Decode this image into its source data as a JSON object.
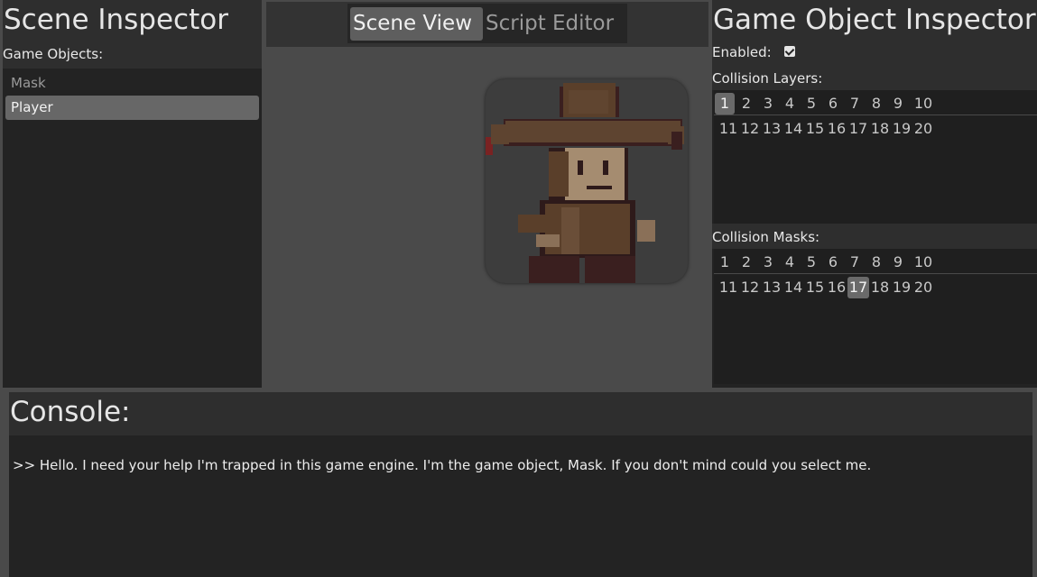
{
  "scene_inspector": {
    "title": "Scene Inspector",
    "objects_label": "Game Objects:",
    "objects": [
      {
        "name": "Mask",
        "selected": false
      },
      {
        "name": "Player",
        "selected": true
      }
    ]
  },
  "center": {
    "tabs": [
      {
        "label": "Scene View",
        "active": true
      },
      {
        "label": "Script Editor",
        "active": false
      }
    ],
    "sprite_icon": "cowboy-character-sprite"
  },
  "inspector": {
    "title": "Game Object Inspector",
    "enabled_label": "Enabled:",
    "enabled_checked": true,
    "layers_label": "Collision Layers:",
    "layers_row1": [
      "1",
      "2",
      "3",
      "4",
      "5",
      "6",
      "7",
      "8",
      "9",
      "10"
    ],
    "layers_row2": [
      "11",
      "12",
      "13",
      "14",
      "15",
      "16",
      "17",
      "18",
      "19",
      "20"
    ],
    "layers_active": [
      "1"
    ],
    "masks_label": "Collision Masks:",
    "masks_row1": [
      "1",
      "2",
      "3",
      "4",
      "5",
      "6",
      "7",
      "8",
      "9",
      "10"
    ],
    "masks_row2": [
      "11",
      "12",
      "13",
      "14",
      "15",
      "16",
      "17",
      "18",
      "19",
      "20"
    ],
    "masks_active": [
      "17"
    ]
  },
  "console": {
    "title": "Console:",
    "text": ">> Hello. I need your help I'm trapped in this game engine. I'm the game object, Mask. If you don't mind could you select me."
  },
  "colors": {
    "background": "#4a4a4a",
    "panel": "#232323",
    "header": "#2e2e2e",
    "selected": "#676767",
    "hat": "#5a3f2a",
    "hat_outline": "#3a1f1f",
    "skin": "#a58c70"
  }
}
